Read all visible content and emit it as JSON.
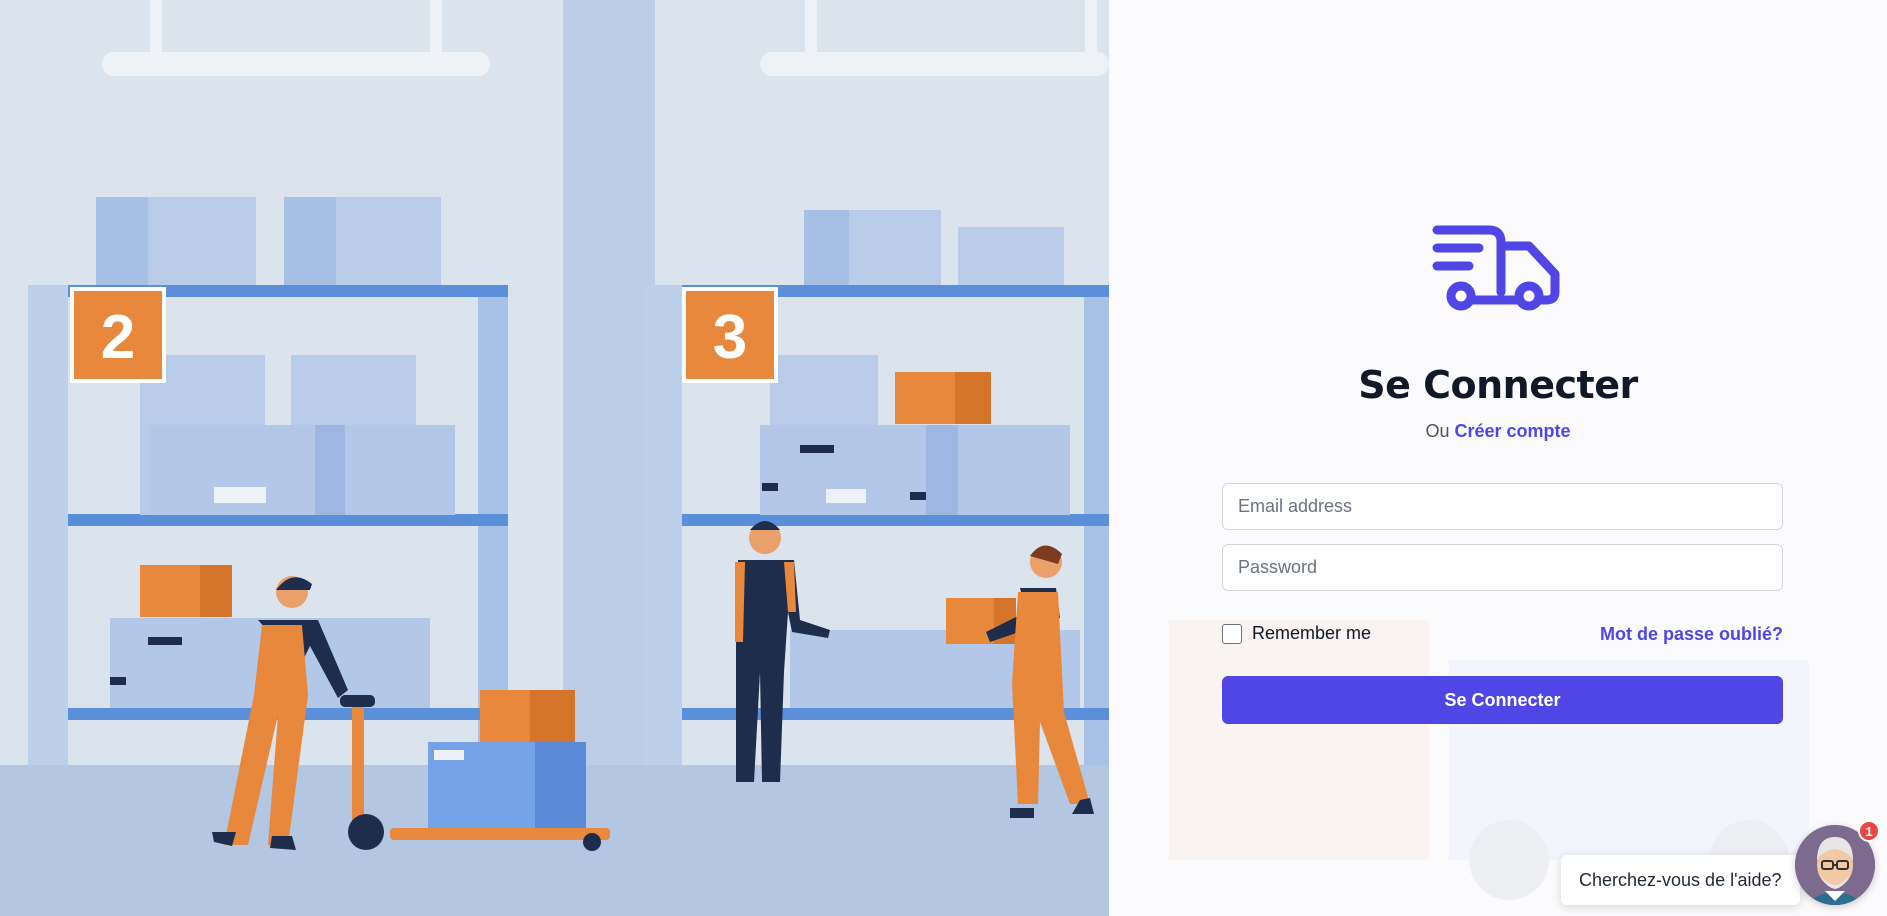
{
  "brand": {
    "accent": "#4f46e5",
    "logo_icon": "truck-icon"
  },
  "illustration": {
    "shelf_labels": [
      "2",
      "3"
    ]
  },
  "login": {
    "title": "Se Connecter",
    "subtitle_prefix": "Ou",
    "create_account_link": "Créer compte",
    "email_placeholder": "Email address",
    "password_placeholder": "Password",
    "remember_label": "Remember me",
    "forgot_link": "Mot de passe oublié?",
    "submit_label": "Se Connecter"
  },
  "help_widget": {
    "message": "Cherchez-vous de l'aide?",
    "badge_count": "1",
    "avatar_icon": "assistant-avatar-icon"
  }
}
